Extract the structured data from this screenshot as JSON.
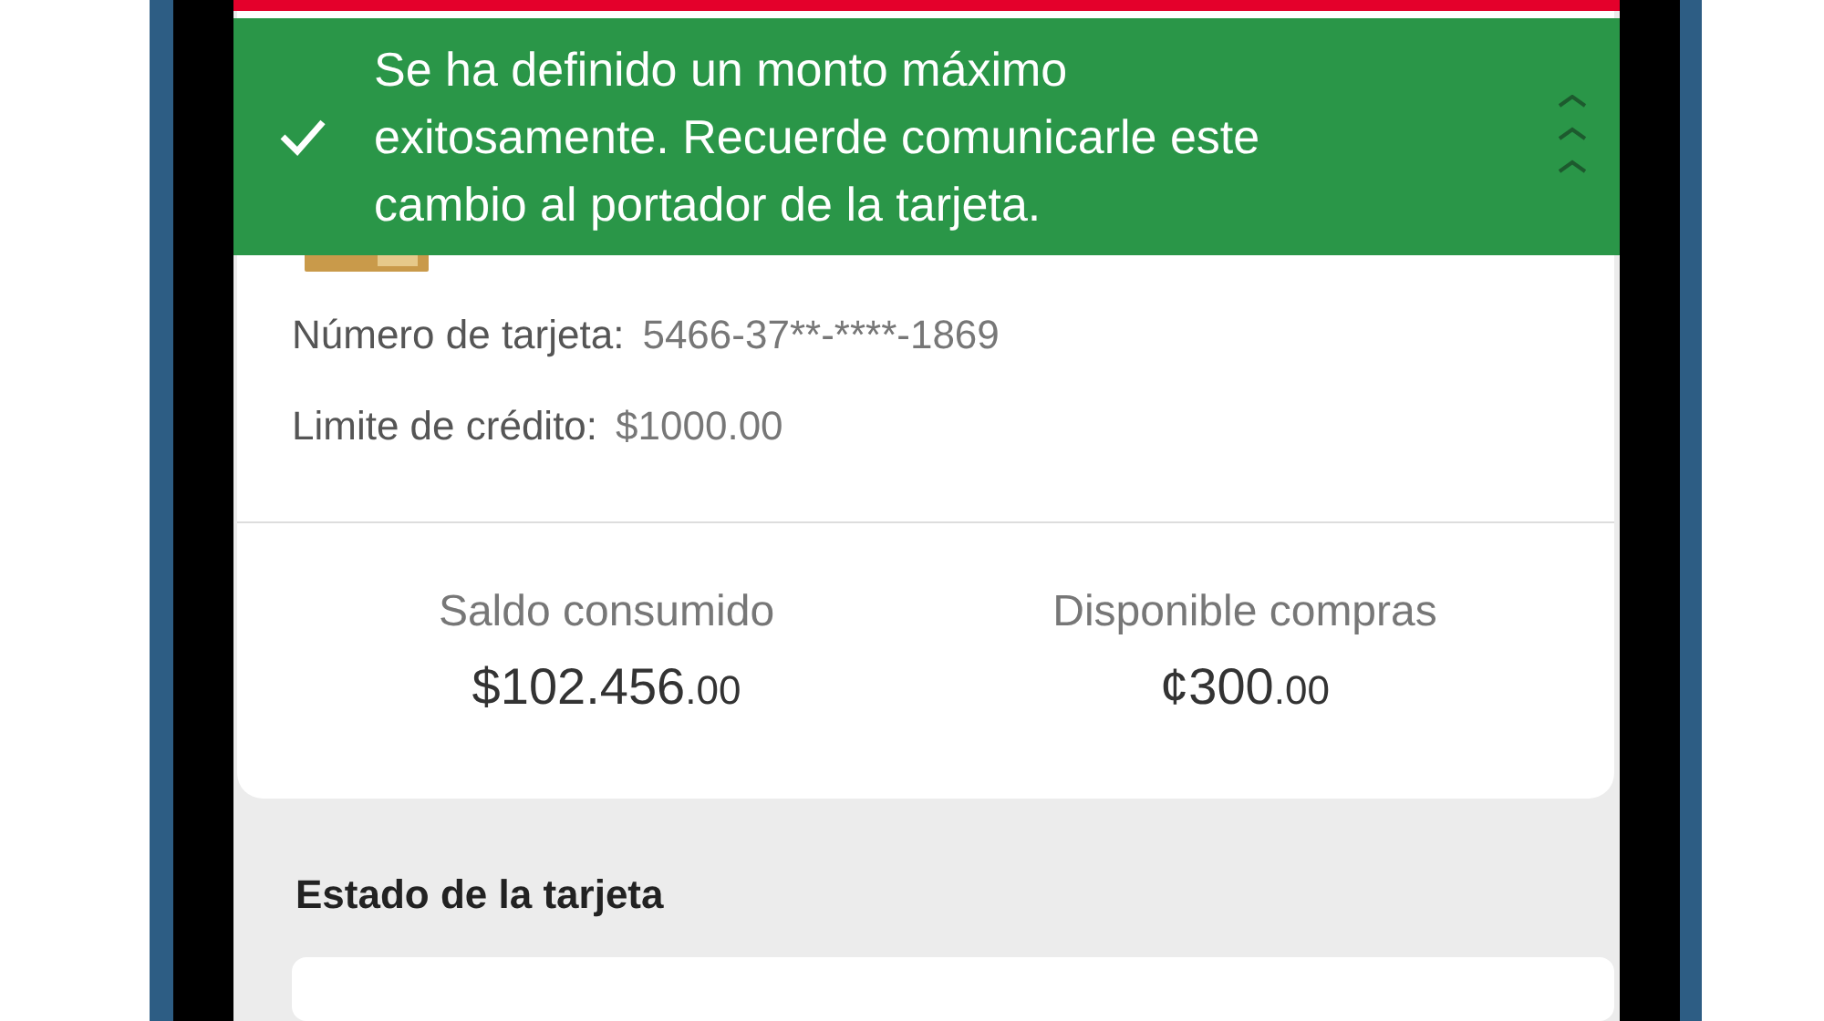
{
  "banner": {
    "message": "Se ha definido un monto máximo exitosamente. Recuerde comunicarle este cambio al portador de la tarjeta.",
    "expanded": true
  },
  "card": {
    "details": [
      {
        "label": "Número de tarjeta:",
        "value": "5466-37**-****-1869"
      },
      {
        "label": "Limite de crédito:",
        "value": "$1000.00"
      }
    ],
    "balances": [
      {
        "label": "Saldo consumido",
        "amount": "$102.456",
        "cents": ".00"
      },
      {
        "label": "Disponible compras",
        "amount": "¢300",
        "cents": ".00"
      }
    ]
  },
  "status_section": {
    "title": "Estado de la tarjeta"
  }
}
